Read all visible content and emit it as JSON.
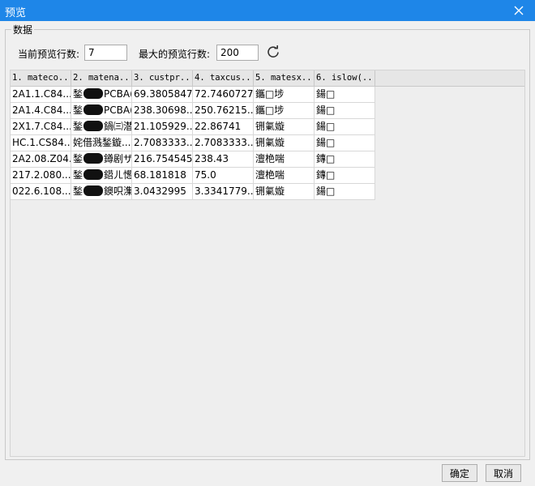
{
  "window": {
    "title": "预览"
  },
  "group": {
    "label": "数据"
  },
  "controls": {
    "current_rows_label": "当前预览行数:",
    "current_rows_value": "7",
    "max_rows_label": "最大的预览行数:",
    "max_rows_value": "200"
  },
  "grid": {
    "columns": [
      "1. mateco...",
      "2. matena...",
      "3. custpr...",
      "4. taxcus...",
      "5. matesx...",
      "6. islow(..."
    ],
    "rows": [
      {
        "c1": "2A1.1.C84...",
        "c2a": "鍫",
        "c2b": "PCBA(...",
        "c3": "69.3805847",
        "c4": "72.7460727",
        "c5": "鑴□埗",
        "c6": "鍚□"
      },
      {
        "c1": "2A1.4.C84...",
        "c2a": "鍫",
        "c2b": "PCBA(...",
        "c3": "238.30698...",
        "c4": "250.76215...",
        "c5": "鑴□埗",
        "c6": "鍚□"
      },
      {
        "c1": "2X1.7.C84...",
        "c2a": "鍫",
        "c2b": "鍋㈢潜...",
        "c3": "21.105929...",
        "c4": "22.86741",
        "c5": "铏氭嫙",
        "c6": "鍚□"
      },
      {
        "c1": "HC.1.CS84...",
        "c2a": "",
        "c2b": "姹借溅鍫鏇...",
        "c3": "2.7083333...",
        "c4": "2.7083333...",
        "c5": "铏氭嫙",
        "c6": "鍚□"
      },
      {
        "c1": "2A2.08.Z04...",
        "c2a": "鍫",
        "c2b": "鐏剧ザ...",
        "c3": "216.754545",
        "c4": "238.43",
        "c5": "澶栬喘",
        "c6": "鏄□"
      },
      {
        "c1": "217.2.080...",
        "c2a": "鍫",
        "c2b": "鍣ㄦ憽...",
        "c3": "68.181818",
        "c4": "75.0",
        "c5": "澶栬喘",
        "c6": "鏄□"
      },
      {
        "c1": "022.6.108...",
        "c2a": "鍫",
        "c2b": "鐭呮潗...",
        "c3": "3.0432995",
        "c4": "3.3341779...",
        "c5": "铏氭嫙",
        "c6": "鍚□"
      }
    ]
  },
  "buttons": {
    "ok": "确定",
    "cancel": "取消"
  }
}
